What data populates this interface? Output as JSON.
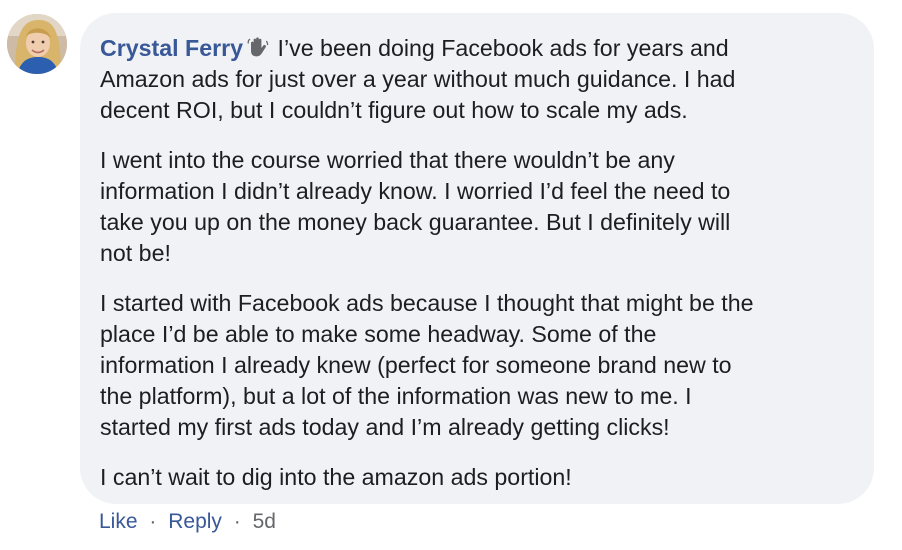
{
  "comment": {
    "author": "Crystal Ferry",
    "badge_icon": "waving-hand-badge-icon",
    "paragraphs": [
      [
        "I’ve been doing Facebook ads for years and",
        "Amazon ads for just over a year without much guidance. I had",
        "decent ROI, but I couldn’t figure out how to scale my ads."
      ],
      [
        "I went into the course worried that there wouldn’t be any",
        "information I didn’t already know. I worried I’d feel the need to",
        "take you up on the money back guarantee. But I definitely will",
        "not be!"
      ],
      [
        "I started with Facebook ads because I thought that might be the",
        "place I’d be able to make some headway. Some of the",
        "information I already knew (perfect for someone brand new to",
        "the platform), but a lot of the information was new to me. I",
        "started my first ads today and I’m already getting clicks!"
      ],
      [
        "I can’t wait to dig into the amazon ads portion!"
      ]
    ]
  },
  "actions": {
    "like": "Like",
    "separator": "·",
    "reply": "Reply",
    "timestamp": "5d"
  },
  "colors": {
    "bubble_bg": "#f0f2f5",
    "author_link": "#385898",
    "body_text": "#1c1e21",
    "meta_text": "#65676b"
  }
}
